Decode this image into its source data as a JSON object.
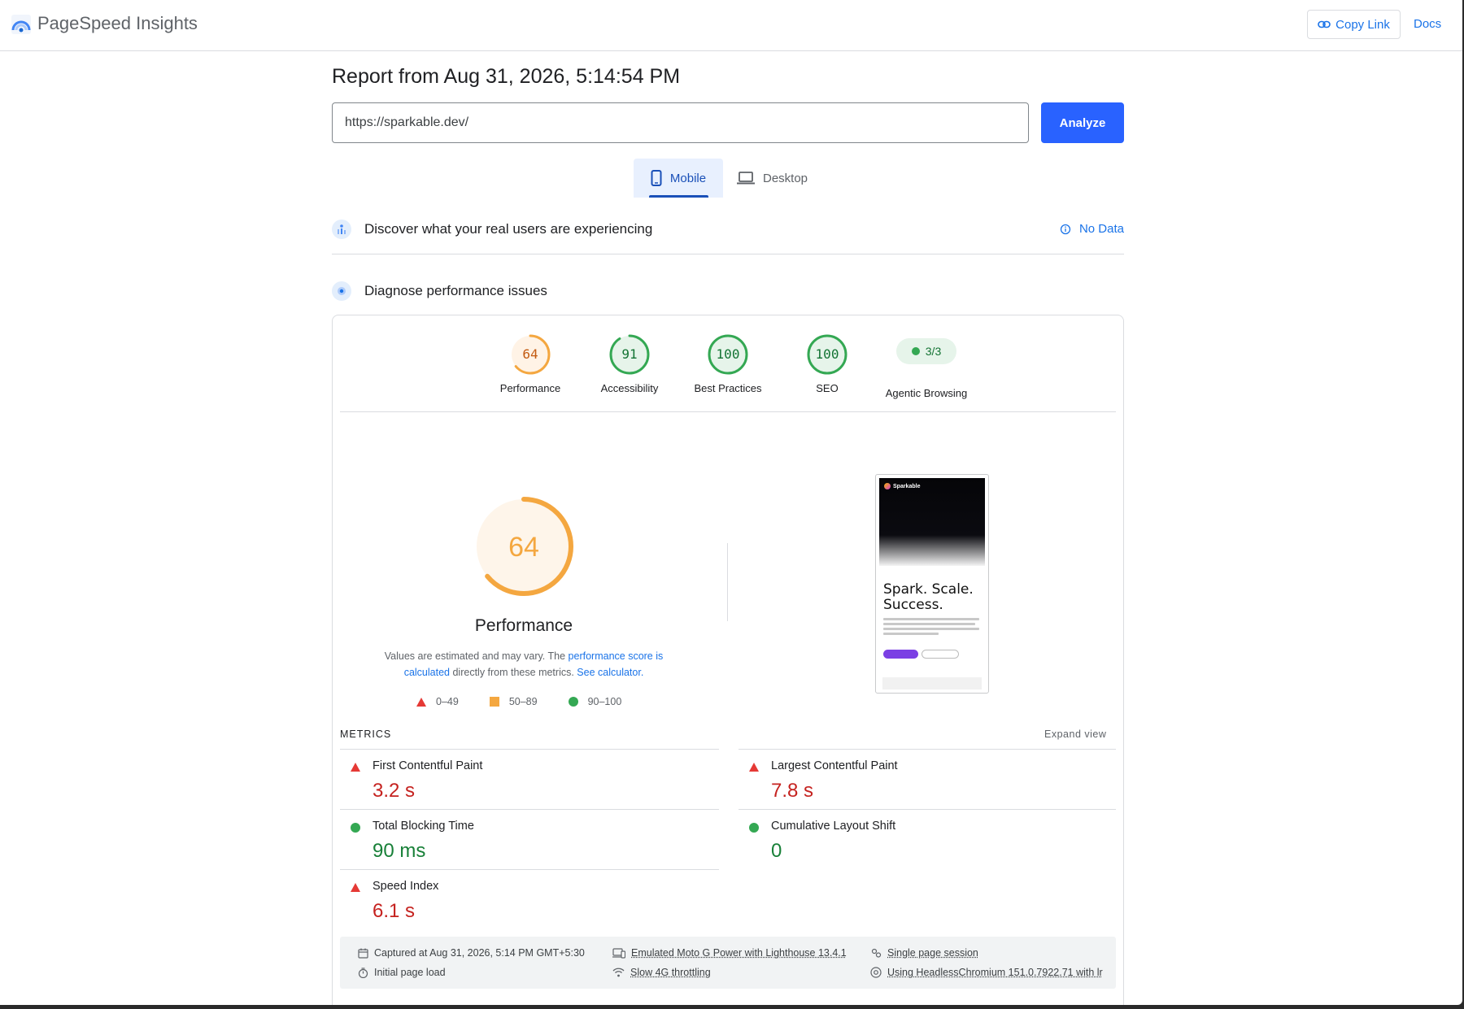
{
  "app": {
    "name": "PageSpeed Insights"
  },
  "header": {
    "copy_link": "Copy Link",
    "docs": "Docs"
  },
  "report": {
    "title": "Report from Aug 31, 2026, 5:14:54 PM"
  },
  "search": {
    "url": "https://sparkable.dev/",
    "analyze": "Analyze"
  },
  "tabs": [
    {
      "label": "Mobile",
      "selected": true
    },
    {
      "label": "Desktop",
      "selected": false
    }
  ],
  "sections": {
    "real_users": {
      "title": "Discover what your real users are experiencing",
      "status": "No Data"
    },
    "diagnose": {
      "title": "Diagnose performance issues"
    }
  },
  "scores": [
    {
      "label": "Performance",
      "value": "64",
      "fraction": 0.64,
      "status": "average"
    },
    {
      "label": "Accessibility",
      "value": "91",
      "fraction": 0.91,
      "status": "pass"
    },
    {
      "label": "Best Practices",
      "value": "100",
      "fraction": 1.0,
      "status": "pass"
    },
    {
      "label": "SEO",
      "value": "100",
      "fraction": 1.0,
      "status": "pass"
    },
    {
      "label": "Agentic Browsing",
      "value": "3/3",
      "status": "pass"
    }
  ],
  "performance": {
    "score": "64",
    "fraction": 0.64,
    "title": "Performance",
    "desc_prefix": "Values are estimated and may vary. The ",
    "desc_link1": "performance score is calculated",
    "desc_middle": " directly from these metrics. ",
    "desc_link2": "See calculator.",
    "legend": [
      "0–49",
      "50–89",
      "90–100"
    ]
  },
  "screenshot": {
    "brand": "Sparkable",
    "headline": "Spark. Scale. Success."
  },
  "metrics": {
    "heading": "METRICS",
    "expand": "Expand view",
    "items": [
      {
        "label": "First Contentful Paint",
        "value": "3.2 s",
        "status": "fail"
      },
      {
        "label": "Largest Contentful Paint",
        "value": "7.8 s",
        "status": "fail"
      },
      {
        "label": "Total Blocking Time",
        "value": "90 ms",
        "status": "pass"
      },
      {
        "label": "Cumulative Layout Shift",
        "value": "0",
        "status": "pass"
      },
      {
        "label": "Speed Index",
        "value": "6.1 s",
        "status": "fail"
      }
    ]
  },
  "environment": {
    "captured": "Captured at Aug 31, 2026, 5:14 PM GMT+5:30",
    "initial": "Initial page load",
    "device": "Emulated Moto G Power with Lighthouse 13.4.1",
    "network": "Slow 4G throttling",
    "session": "Single page session",
    "browser": "Using HeadlessChromium 151.0.7922.71 with lr"
  },
  "colors": {
    "accent": "#1a73e8",
    "button": "#2962ff",
    "fail": "#c5221f",
    "average": "#f4a740",
    "pass": "#34a853"
  }
}
